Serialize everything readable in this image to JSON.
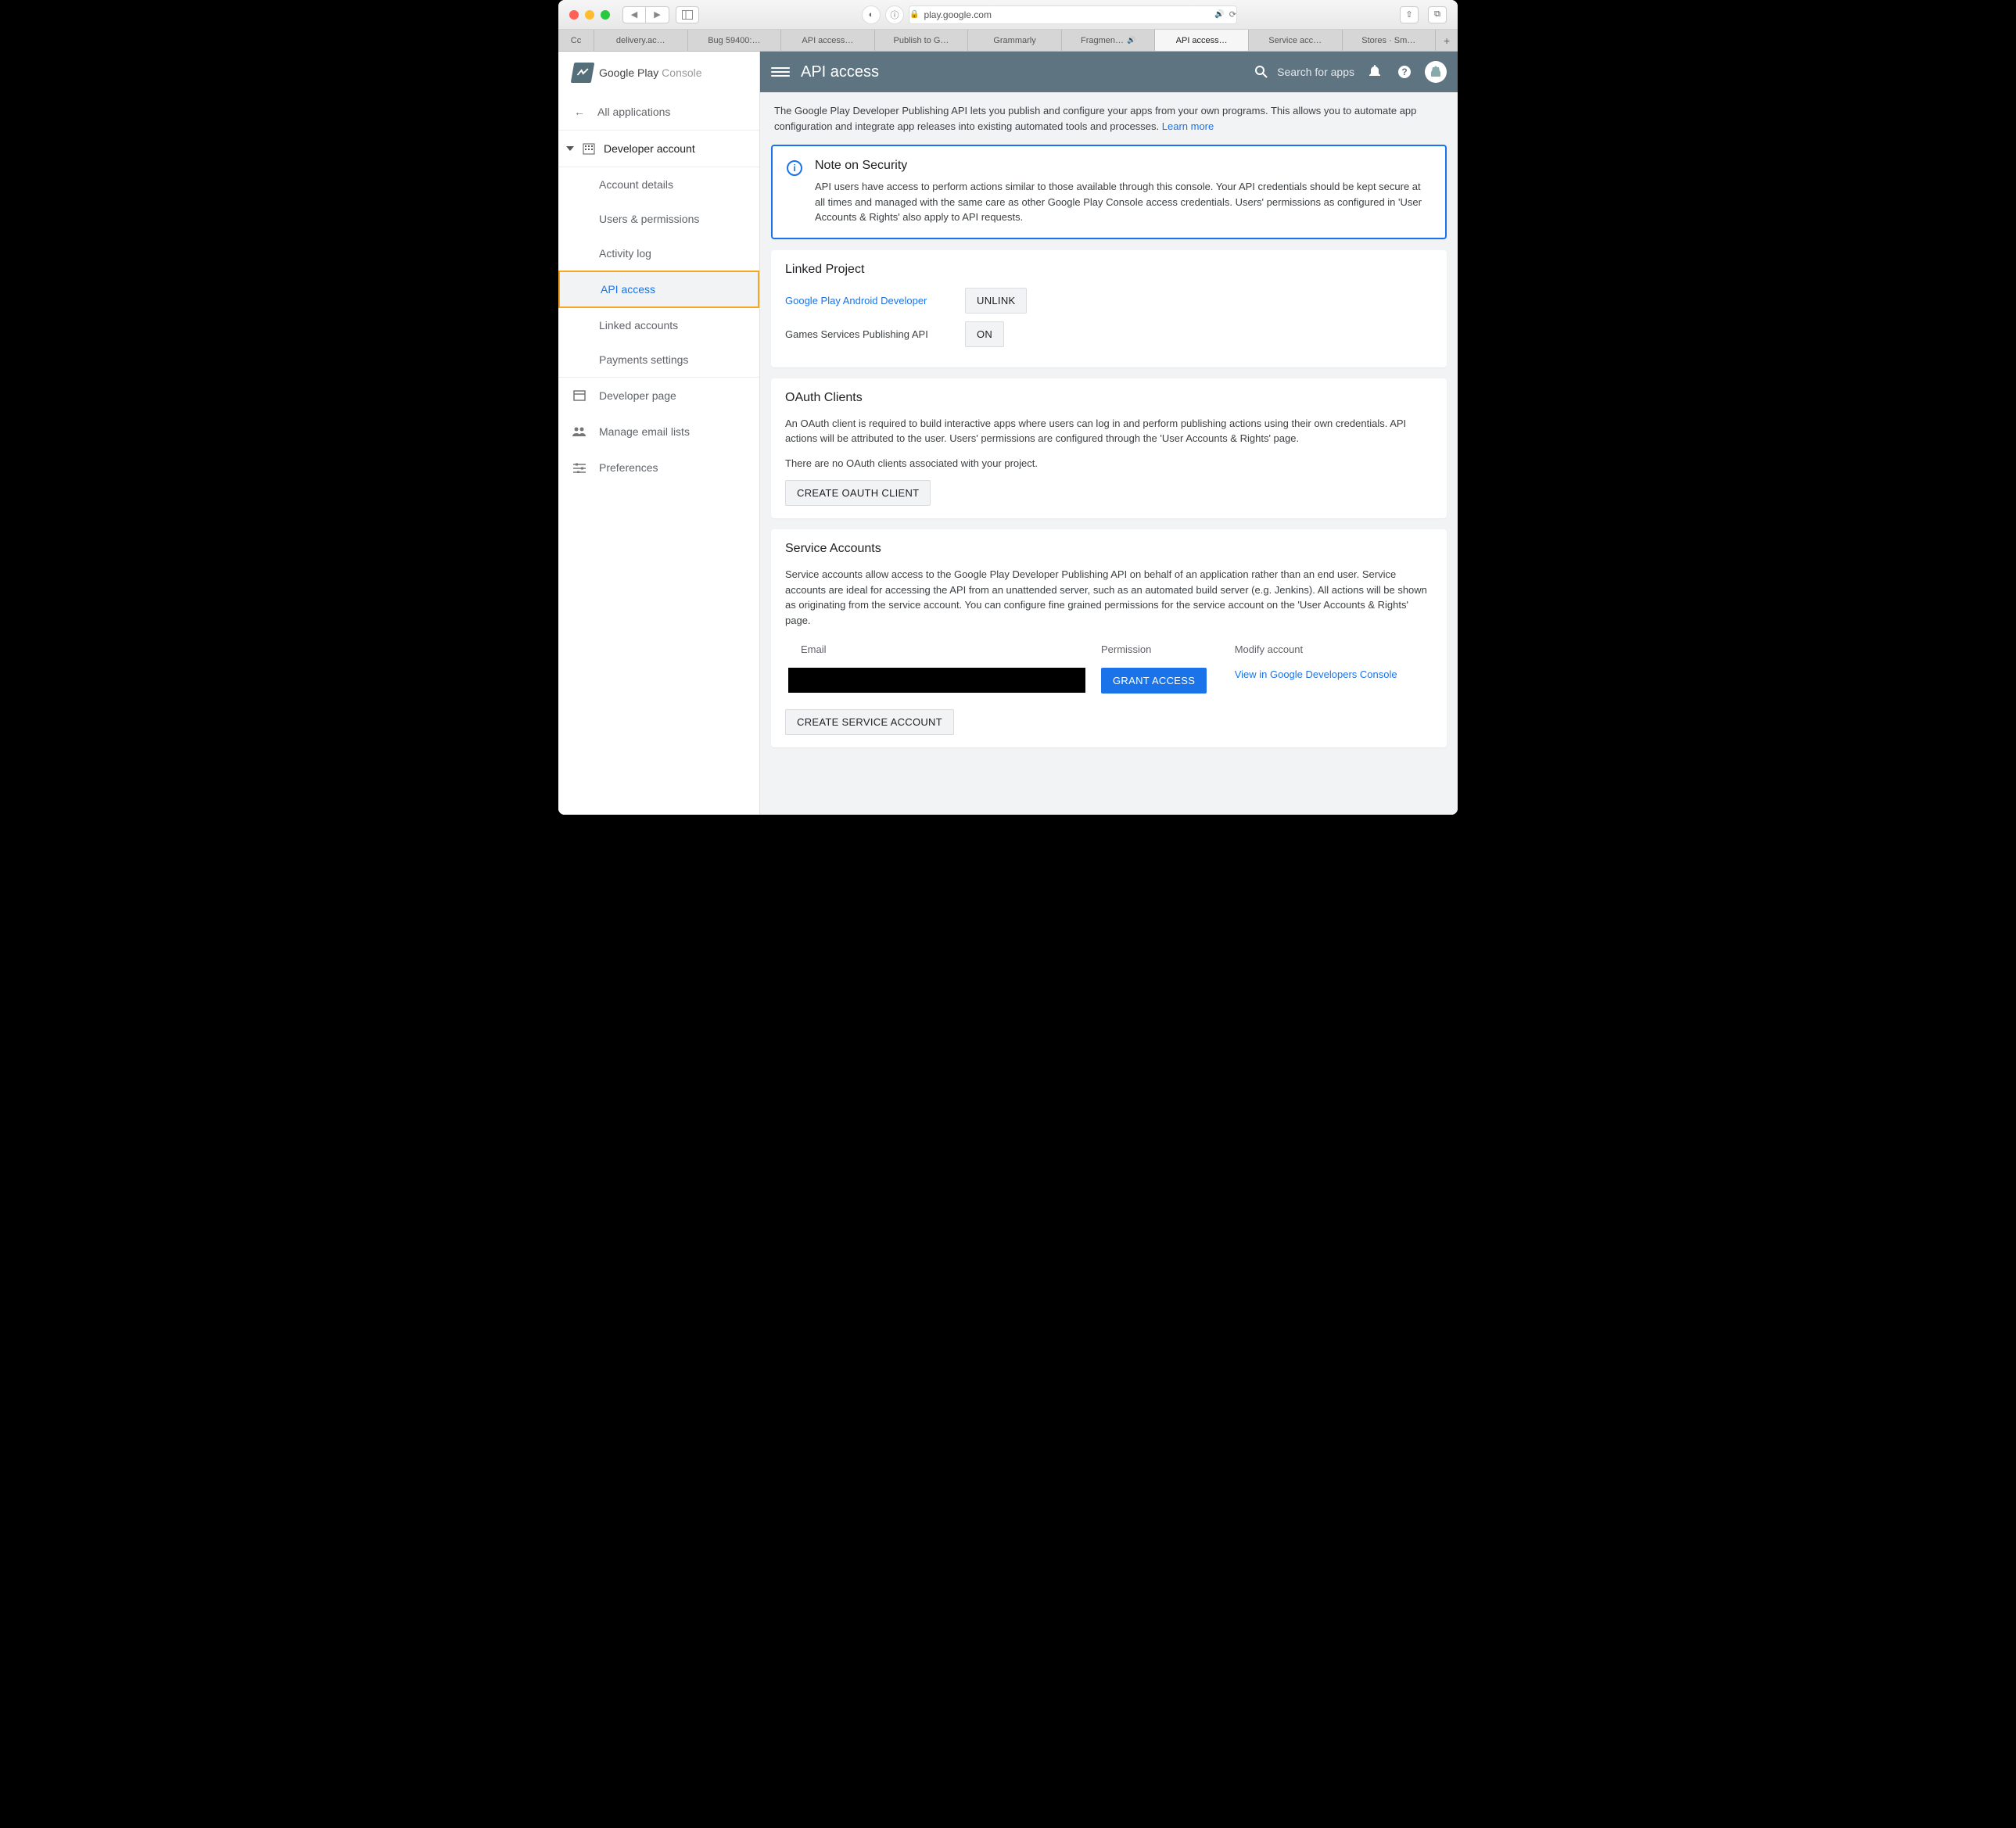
{
  "browser": {
    "url": "play.google.com",
    "tabs": [
      "Cc",
      "delivery.ac…",
      "Bug 59400:…",
      "API access…",
      "Publish to G…",
      "Grammarly",
      "Fragmen…",
      "API access…",
      "Service acc…",
      "Stores · Sm…"
    ],
    "active_tab_index": 7
  },
  "logo": "Google Play",
  "logo_suffix": "Console",
  "sidebar": {
    "all_apps": "All applications",
    "dev_account": "Developer account",
    "subitems": [
      "Account details",
      "Users & permissions",
      "Activity log",
      "API access",
      "Linked accounts",
      "Payments settings"
    ],
    "selected_index": 3,
    "footer": [
      "Developer page",
      "Manage email lists",
      "Preferences"
    ]
  },
  "topbar": {
    "title": "API access",
    "search_ph": "Search for apps"
  },
  "intro": {
    "text": "The Google Play Developer Publishing API lets you publish and configure your apps from your own programs. This allows you to automate app configuration and integrate app releases into existing automated tools and processes. ",
    "learn_more": "Learn more"
  },
  "note": {
    "title": "Note on Security",
    "body": "API users have access to perform actions similar to those available through this console. Your API credentials should be kept secure at all times and managed with the same care as other Google Play Console access credentials. Users' permissions as configured in 'User Accounts & Rights' also apply to API requests."
  },
  "linked": {
    "title": "Linked Project",
    "link_label": "Google Play Android Developer",
    "unlink_btn": "Unlink",
    "games_label": "Games Services Publishing API",
    "on_btn": "On"
  },
  "oauth": {
    "title": "OAuth Clients",
    "desc": "An OAuth client is required to build interactive apps where users can log in and perform publishing actions using their own credentials. API actions will be attributed to the user. Users' permissions are configured through the 'User Accounts & Rights' page.",
    "empty": "There are no OAuth clients associated with your project.",
    "create_btn": "Create OAuth Client"
  },
  "sa": {
    "title": "Service Accounts",
    "desc": "Service accounts allow access to the Google Play Developer Publishing API on behalf of an application rather than an end user. Service accounts are ideal for accessing the API from an unattended server, such as an automated build server (e.g. Jenkins). All actions will be shown as originating from the service account. You can configure fine grained permissions for the service account on the 'User Accounts & Rights' page.",
    "th_email": "Email",
    "th_perm": "Permission",
    "th_modify": "Modify account",
    "grant_btn": "Grant Access",
    "view_link": "View in Google Developers Console",
    "create_btn": "Create Service Account"
  }
}
